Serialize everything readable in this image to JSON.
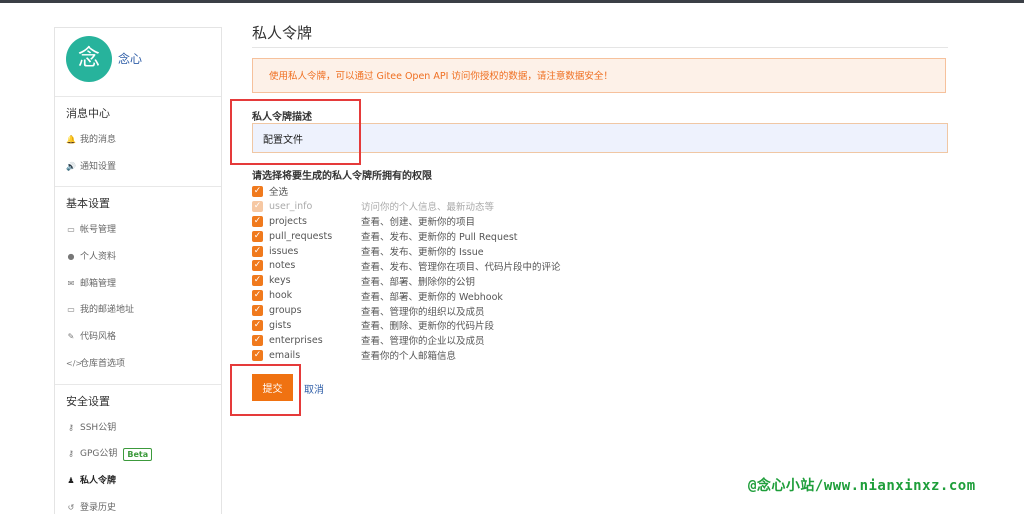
{
  "user": {
    "avatar_char": "念",
    "name": "念心"
  },
  "sidebar": {
    "groups": [
      {
        "title": "消息中心",
        "items": [
          {
            "icon": "bell-icon",
            "glyph": "🔔",
            "label": "我的消息"
          },
          {
            "icon": "speaker-icon",
            "glyph": "🔊",
            "label": "通知设置"
          }
        ]
      },
      {
        "title": "基本设置",
        "items": [
          {
            "icon": "id-card-icon",
            "glyph": "▭",
            "label": "帐号管理"
          },
          {
            "icon": "user-icon",
            "glyph": "●",
            "label": "个人资料"
          },
          {
            "icon": "envelope-icon",
            "glyph": "✉",
            "label": "邮箱管理"
          },
          {
            "icon": "address-card-icon",
            "glyph": "▭",
            "label": "我的邮递地址"
          },
          {
            "icon": "paintbrush-icon",
            "glyph": "✎",
            "label": "代码风格"
          },
          {
            "icon": "code-icon",
            "glyph": "</>",
            "label": "仓库首选项"
          }
        ]
      },
      {
        "title": "安全设置",
        "items": [
          {
            "icon": "key-icon",
            "glyph": "⚷",
            "label": "SSH公钥"
          },
          {
            "icon": "key-icon",
            "glyph": "⚷",
            "label": "GPG公钥",
            "badge": "Beta"
          },
          {
            "icon": "user-secret-icon",
            "glyph": "♟",
            "label": "私人令牌"
          },
          {
            "icon": "history-icon",
            "glyph": "↺",
            "label": "登录历史"
          }
        ]
      }
    ]
  },
  "main": {
    "title": "私人令牌",
    "notice": "使用私人令牌，可以通过 Gitee Open API 访问你授权的数据，请注意数据安全！",
    "desc_label": "私人令牌描述",
    "desc_value": "配置文件",
    "perm_title": "请选择将要生成的私人令牌所拥有的权限",
    "select_all": "全选",
    "permissions": [
      {
        "name": "user_info",
        "desc": "访问你的个人信息、最新动态等",
        "disabled": true
      },
      {
        "name": "projects",
        "desc": "查看、创建、更新你的项目"
      },
      {
        "name": "pull_requests",
        "desc": "查看、发布、更新你的 Pull Request"
      },
      {
        "name": "issues",
        "desc": "查看、发布、更新你的 Issue"
      },
      {
        "name": "notes",
        "desc": "查看、发布、管理你在项目、代码片段中的评论"
      },
      {
        "name": "keys",
        "desc": "查看、部署、删除你的公钥"
      },
      {
        "name": "hook",
        "desc": "查看、部署、更新你的 Webhook"
      },
      {
        "name": "groups",
        "desc": "查看、管理你的组织以及成员"
      },
      {
        "name": "gists",
        "desc": "查看、删除、更新你的代码片段"
      },
      {
        "name": "enterprises",
        "desc": "查看、管理你的企业以及成员"
      },
      {
        "name": "emails",
        "desc": "查看你的个人邮箱信息"
      }
    ],
    "submit": "提交",
    "cancel": "取消"
  },
  "colors": {
    "accent": "#f07211",
    "link": "#305fa8",
    "highlight": "#e53a3a"
  },
  "watermark": "@念心小站/www.nianxinxz.com"
}
